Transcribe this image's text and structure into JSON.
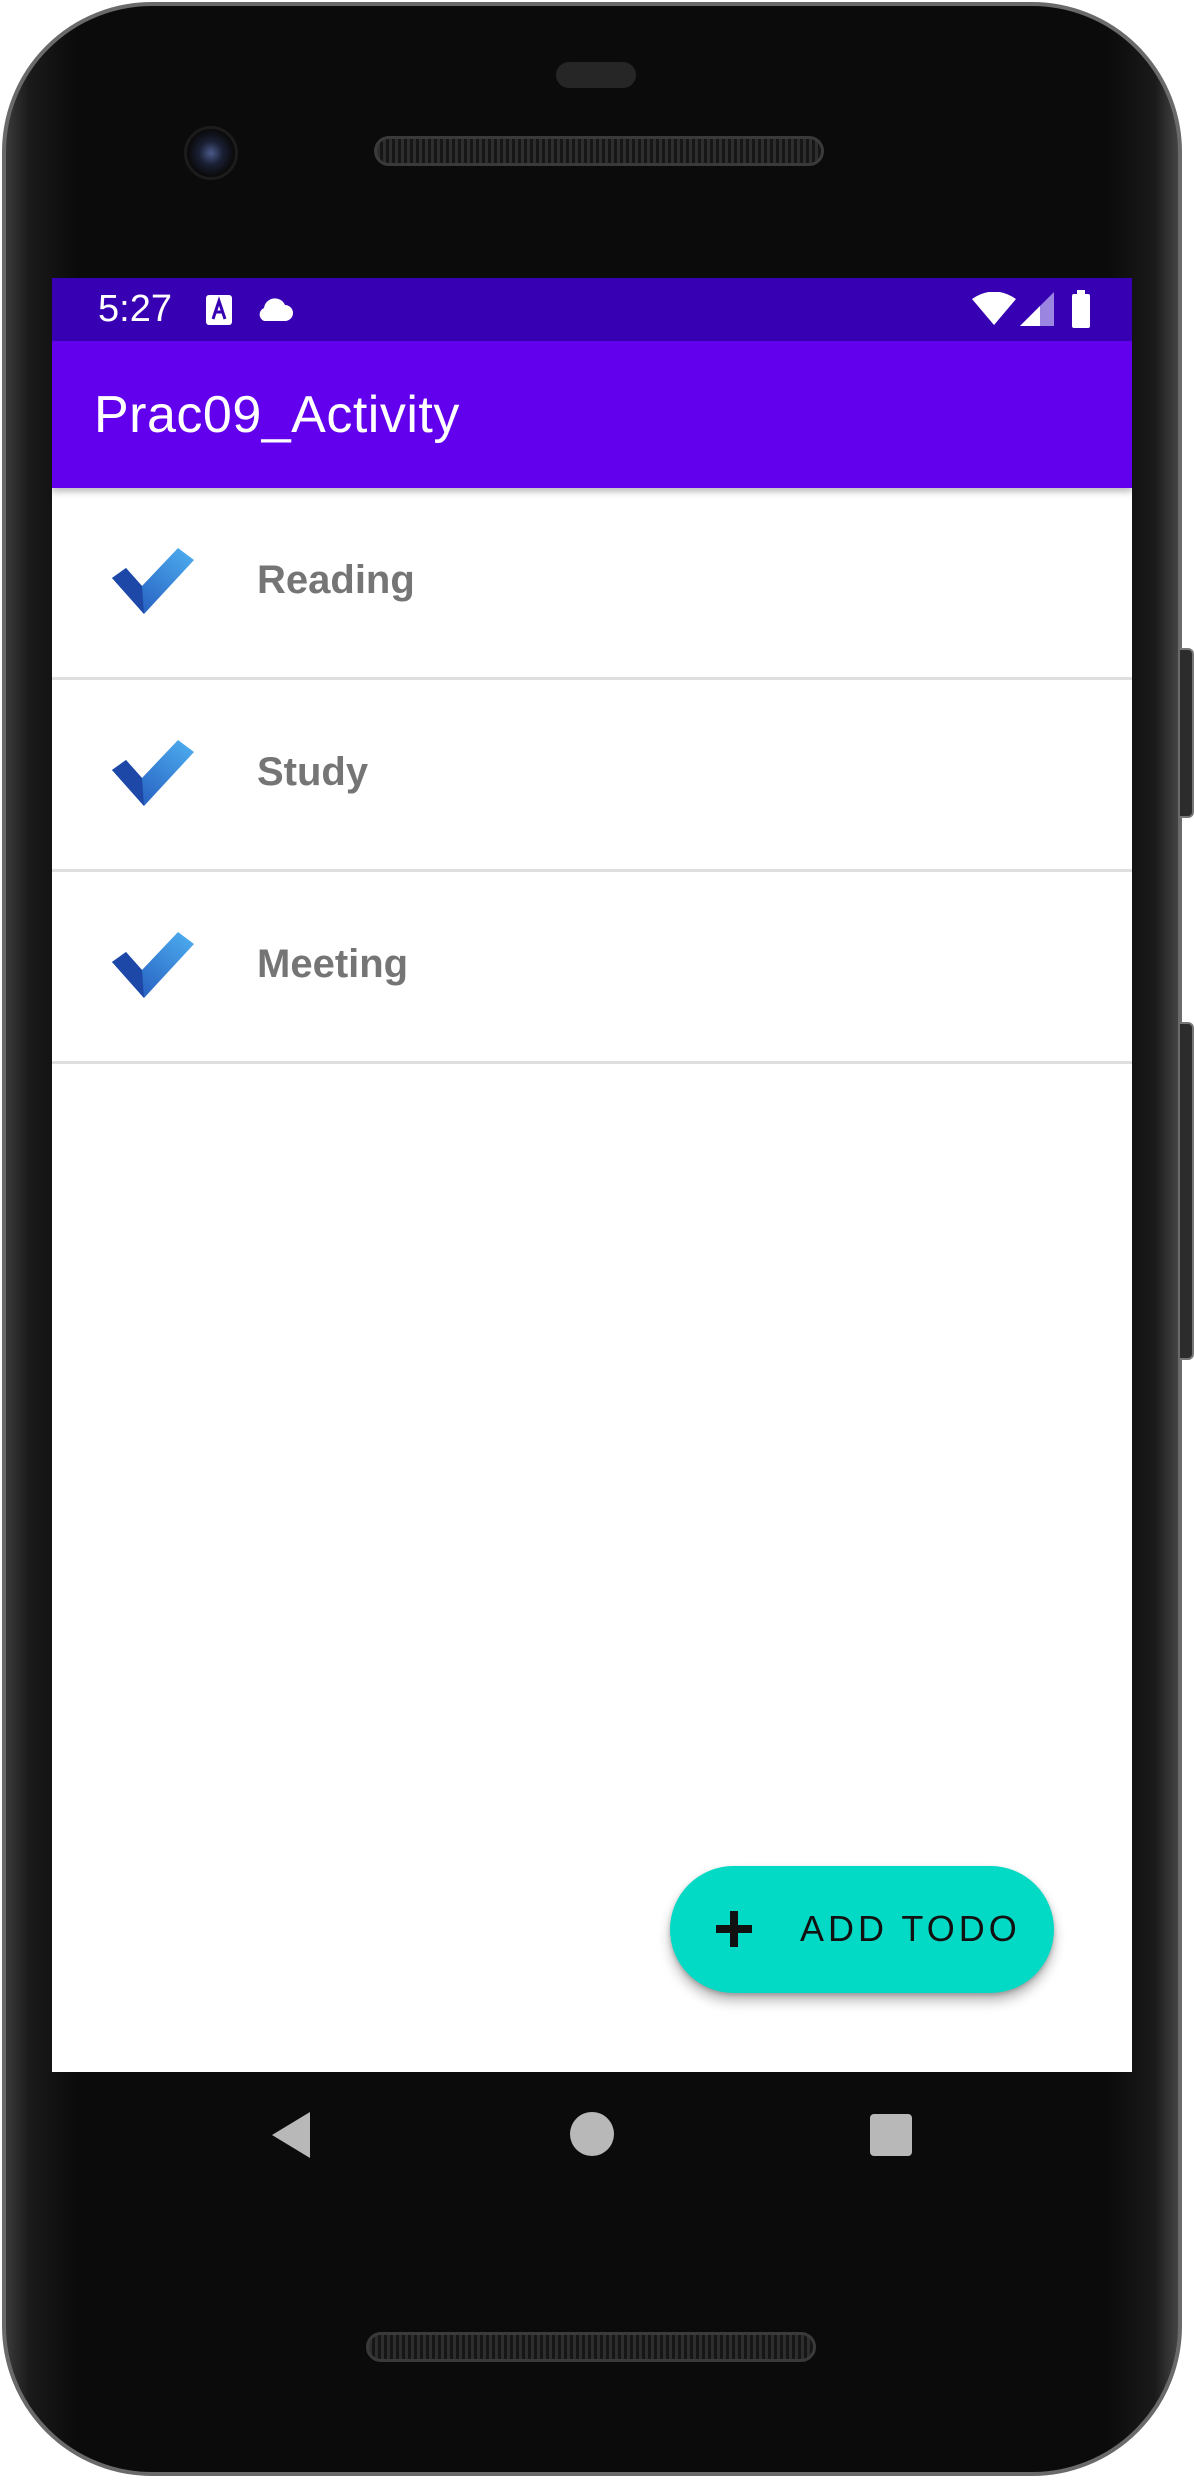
{
  "status_bar": {
    "time": "5:27",
    "icons": [
      "accessibility-a-icon",
      "cloud-icon",
      "wifi-icon",
      "signal-icon",
      "battery-icon"
    ],
    "background": "#3700b3"
  },
  "app_bar": {
    "title": "Prac09_Activity",
    "background": "#6200ee"
  },
  "todos": [
    {
      "label": "Reading",
      "icon": "checkmark-icon"
    },
    {
      "label": "Study",
      "icon": "checkmark-icon"
    },
    {
      "label": "Meeting",
      "icon": "checkmark-icon"
    }
  ],
  "fab": {
    "label": "ADD TODO",
    "icon": "plus-icon",
    "color": "#03dac5"
  },
  "navigation": {
    "buttons": [
      "back-icon",
      "home-icon",
      "recents-icon"
    ]
  }
}
